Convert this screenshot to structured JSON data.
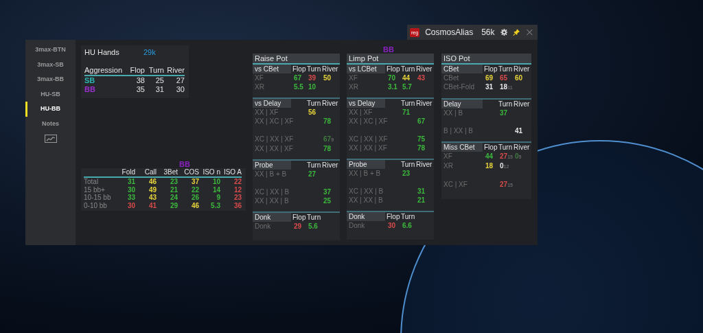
{
  "titlebar": {
    "logo": "reg",
    "name": "CosmosAlias",
    "count": "56k"
  },
  "sidebar": {
    "items": [
      {
        "kind": "label",
        "label": "3max-BTN",
        "selected": false
      },
      {
        "kind": "label",
        "label": "3max-SB",
        "selected": false
      },
      {
        "kind": "label",
        "label": "3max-BB",
        "selected": false
      },
      {
        "kind": "label",
        "label": "HU-SB",
        "selected": false
      },
      {
        "kind": "label",
        "label": "HU-BB",
        "selected": true
      },
      {
        "kind": "label",
        "label": "Notes",
        "selected": false
      },
      {
        "kind": "chart",
        "selected": false
      }
    ]
  },
  "hu_hands": {
    "label": "HU Hands",
    "value": "29k"
  },
  "aggression": {
    "columns": [
      "Aggression",
      "Flop",
      "Turn",
      "River"
    ],
    "rows": [
      {
        "label": "SB",
        "color": "#2bb5b0",
        "values": [
          "38",
          "25",
          "27"
        ]
      },
      {
        "label": "BB",
        "color": "#9b2fd0",
        "values": [
          "35",
          "31",
          "30"
        ]
      }
    ]
  },
  "bb_stats": {
    "title": "BB",
    "columns": [
      "Fold",
      "Call",
      "3Bet",
      "COS",
      "ISO n",
      "ISO A"
    ],
    "rows": [
      {
        "label": "Total",
        "cells": [
          {
            "text": "31",
            "color": "#3cb83c"
          },
          {
            "text": "46",
            "color": "#e8d53a"
          },
          {
            "text": "23",
            "color": "#3cb83c"
          },
          {
            "text": "37",
            "color": "#e8d53a"
          },
          {
            "text": "10",
            "color": "#3cb83c"
          },
          {
            "text": "22",
            "color": "#d94a4a"
          }
        ]
      },
      {
        "label": "15 bb+",
        "cells": [
          {
            "text": "30",
            "color": "#3cb83c"
          },
          {
            "text": "49",
            "color": "#e8d53a"
          },
          {
            "text": "21",
            "color": "#3cb83c"
          },
          {
            "text": "22",
            "color": "#3cb83c"
          },
          {
            "text": "14",
            "color": "#3cb83c"
          },
          {
            "text": "12",
            "color": "#d94a4a"
          }
        ]
      },
      {
        "label": "10-15 bb",
        "cells": [
          {
            "text": "33",
            "color": "#3cb83c"
          },
          {
            "text": "43",
            "color": "#e8d53a"
          },
          {
            "text": "24",
            "color": "#3cb83c"
          },
          {
            "text": "26",
            "color": "#3cb83c"
          },
          {
            "text": "9",
            "color": "#3cb83c"
          },
          {
            "text": "23",
            "color": "#d94a4a"
          }
        ]
      },
      {
        "label": "0-10 bb",
        "cells": [
          {
            "text": "30",
            "color": "#d94a4a"
          },
          {
            "text": "41",
            "color": "#d94a4a"
          },
          {
            "text": "29",
            "color": "#3cb83c"
          },
          {
            "text": "46",
            "color": "#e8d53a"
          },
          {
            "text": "5.3",
            "color": "#3cb83c"
          },
          {
            "text": "36",
            "color": "#d94a4a"
          }
        ]
      }
    ]
  },
  "player_title": "BB",
  "pots": [
    {
      "title": "Raise Pot",
      "sections": [
        {
          "label": "vs CBet",
          "columns": [
            "Flop",
            "Turn",
            "River"
          ],
          "rows": [
            {
              "kind": "stat",
              "label": "XF",
              "cells": [
                {
                  "text": "67",
                  "color": "#3cb83c"
                },
                {
                  "text": "39",
                  "color": "#d94a4a"
                },
                {
                  "text": "50",
                  "color": "#e8d53a"
                }
              ]
            },
            {
              "kind": "stat",
              "label": "XR",
              "cells": [
                {
                  "text": "5.5",
                  "color": "#3cb83c"
                },
                {
                  "text": "10",
                  "color": "#3cb83c"
                },
                null
              ]
            }
          ]
        },
        {
          "label": "vs Delay",
          "columns": [
            null,
            "Turn",
            "River"
          ],
          "rows": [
            {
              "kind": "stat",
              "label": "XX | XF",
              "cells": [
                null,
                {
                  "text": "56",
                  "color": "#e8d53a"
                },
                null
              ]
            },
            {
              "kind": "stat",
              "label": "XX | XC | XF",
              "cells": [
                null,
                null,
                {
                  "text": "78",
                  "color": "#3cb83c"
                }
              ]
            },
            {
              "kind": "gap"
            },
            {
              "kind": "stat",
              "label": "XC | XX | XF",
              "cells": [
                null,
                null,
                {
                  "text": "67$_{9}$",
                  "color": "#3f7a3f"
                }
              ]
            },
            {
              "kind": "stat",
              "label": "XX | XX | XF",
              "cells": [
                null,
                null,
                {
                  "text": "78",
                  "color": "#3cb83c"
                }
              ]
            }
          ]
        },
        {
          "label": "Probe",
          "columns": [
            null,
            "Turn",
            "River"
          ],
          "rows": [
            {
              "kind": "stat",
              "label": "XX | B + B",
              "cells": [
                null,
                {
                  "text": "27",
                  "color": "#3cb83c"
                },
                null
              ]
            },
            {
              "kind": "gap"
            },
            {
              "kind": "stat",
              "label": "XC | XX | B",
              "cells": [
                null,
                null,
                {
                  "text": "37",
                  "color": "#3cb83c"
                }
              ]
            },
            {
              "kind": "stat",
              "label": "XX | XX | B",
              "cells": [
                null,
                null,
                {
                  "text": "25",
                  "color": "#3cb83c"
                }
              ]
            }
          ]
        },
        {
          "label": "Donk",
          "columns": [
            "Flop",
            "Turn",
            null
          ],
          "rows": [
            {
              "kind": "stat",
              "label": "Donk",
              "cells": [
                {
                  "text": "29",
                  "color": "#d94a4a"
                },
                {
                  "text": "5.6",
                  "color": "#3cb83c"
                },
                null
              ]
            }
          ]
        }
      ]
    },
    {
      "title": "Limp Pot",
      "sections": [
        {
          "label": "vs LCBet",
          "columns": [
            "Flop",
            "Turn",
            "River"
          ],
          "rows": [
            {
              "kind": "stat",
              "label": "XF",
              "cells": [
                {
                  "text": "70",
                  "color": "#3cb83c"
                },
                {
                  "text": "44",
                  "color": "#e8d53a"
                },
                {
                  "text": "43",
                  "color": "#d94a4a"
                }
              ]
            },
            {
              "kind": "stat",
              "label": "XR",
              "cells": [
                {
                  "text": "3.1",
                  "color": "#3cb83c"
                },
                {
                  "text": "5.7",
                  "color": "#3cb83c"
                },
                null
              ]
            }
          ]
        },
        {
          "label": "vs Delay",
          "columns": [
            null,
            "Turn",
            "River"
          ],
          "rows": [
            {
              "kind": "stat",
              "label": "XX | XF",
              "cells": [
                null,
                {
                  "text": "71",
                  "color": "#3cb83c"
                },
                null
              ]
            },
            {
              "kind": "stat",
              "label": "XX | XC | XF",
              "cells": [
                null,
                null,
                {
                  "text": "67",
                  "color": "#3cb83c"
                }
              ]
            },
            {
              "kind": "gap"
            },
            {
              "kind": "stat",
              "label": "XC | XX | XF",
              "cells": [
                null,
                null,
                {
                  "text": "75",
                  "color": "#3cb83c"
                }
              ]
            },
            {
              "kind": "stat",
              "label": "XX | XX | XF",
              "cells": [
                null,
                null,
                {
                  "text": "78",
                  "color": "#3cb83c"
                }
              ]
            }
          ]
        },
        {
          "label": "Probe",
          "columns": [
            null,
            "Turn",
            "River"
          ],
          "rows": [
            {
              "kind": "stat",
              "label": "XX | B + B",
              "cells": [
                null,
                {
                  "text": "23",
                  "color": "#3cb83c"
                },
                null
              ]
            },
            {
              "kind": "gap"
            },
            {
              "kind": "stat",
              "label": "XC | XX | B",
              "cells": [
                null,
                null,
                {
                  "text": "31",
                  "color": "#3cb83c"
                }
              ]
            },
            {
              "kind": "stat",
              "label": "XX | XX | B",
              "cells": [
                null,
                null,
                {
                  "text": "21",
                  "color": "#3cb83c"
                }
              ]
            }
          ]
        },
        {
          "label": "Donk",
          "columns": [
            "Flop",
            "Turn",
            null
          ],
          "rows": [
            {
              "kind": "stat",
              "label": "Donk",
              "cells": [
                {
                  "text": "30",
                  "color": "#d94a4a"
                },
                {
                  "text": "6.6",
                  "color": "#3cb83c"
                },
                null
              ]
            }
          ]
        }
      ]
    },
    {
      "title": "ISO Pot",
      "sections": [
        {
          "label": "CBet",
          "columns": [
            "Flop",
            "Turn",
            "River"
          ],
          "rows": [
            {
              "kind": "stat",
              "label": "CBet",
              "cells": [
                {
                  "text": "69",
                  "color": "#e8d53a"
                },
                {
                  "text": "65",
                  "color": "#d94a4a"
                },
                {
                  "text": "60",
                  "color": "#e8d53a"
                }
              ]
            },
            {
              "kind": "stat",
              "label": "CBet-Fold",
              "cells": [
                {
                  "text": "31",
                  "color": "#e6e6e6"
                },
                {
                  "text": "18$_{11}$",
                  "color": "#e6e6e6"
                },
                null
              ]
            }
          ]
        },
        {
          "label": "Delay",
          "columns": [
            null,
            "Turn",
            "River"
          ],
          "rows": [
            {
              "kind": "stat",
              "label": "XX | B",
              "cells": [
                null,
                {
                  "text": "37",
                  "color": "#3cb83c"
                },
                null
              ]
            },
            {
              "kind": "gap"
            },
            {
              "kind": "stat",
              "label": "B | XX | B",
              "cells": [
                null,
                null,
                {
                  "text": "41",
                  "color": "#e6e6e6"
                }
              ]
            }
          ]
        },
        {
          "label": "Miss CBet",
          "columns": [
            "Flop",
            "Turn",
            "River"
          ],
          "rows": [
            {
              "kind": "stat",
              "label": "XF",
              "cells": [
                {
                  "text": "44",
                  "color": "#3cb83c"
                },
                {
                  "text": "27$_{15}$",
                  "color": "#d94a4a"
                },
                {
                  "text": "0$_{5}$",
                  "color": "#3f7a3f"
                }
              ]
            },
            {
              "kind": "stat",
              "label": "XR",
              "cells": [
                {
                  "text": "18",
                  "color": "#e8d53a"
                },
                {
                  "text": "0$_{12}$",
                  "color": "#e6e6e6"
                },
                null
              ]
            },
            {
              "kind": "gap"
            },
            {
              "kind": "stat",
              "label": "XC | XF",
              "cells": [
                null,
                {
                  "text": "27$_{15}$",
                  "color": "#d94a4a"
                },
                null
              ]
            }
          ]
        }
      ]
    }
  ]
}
